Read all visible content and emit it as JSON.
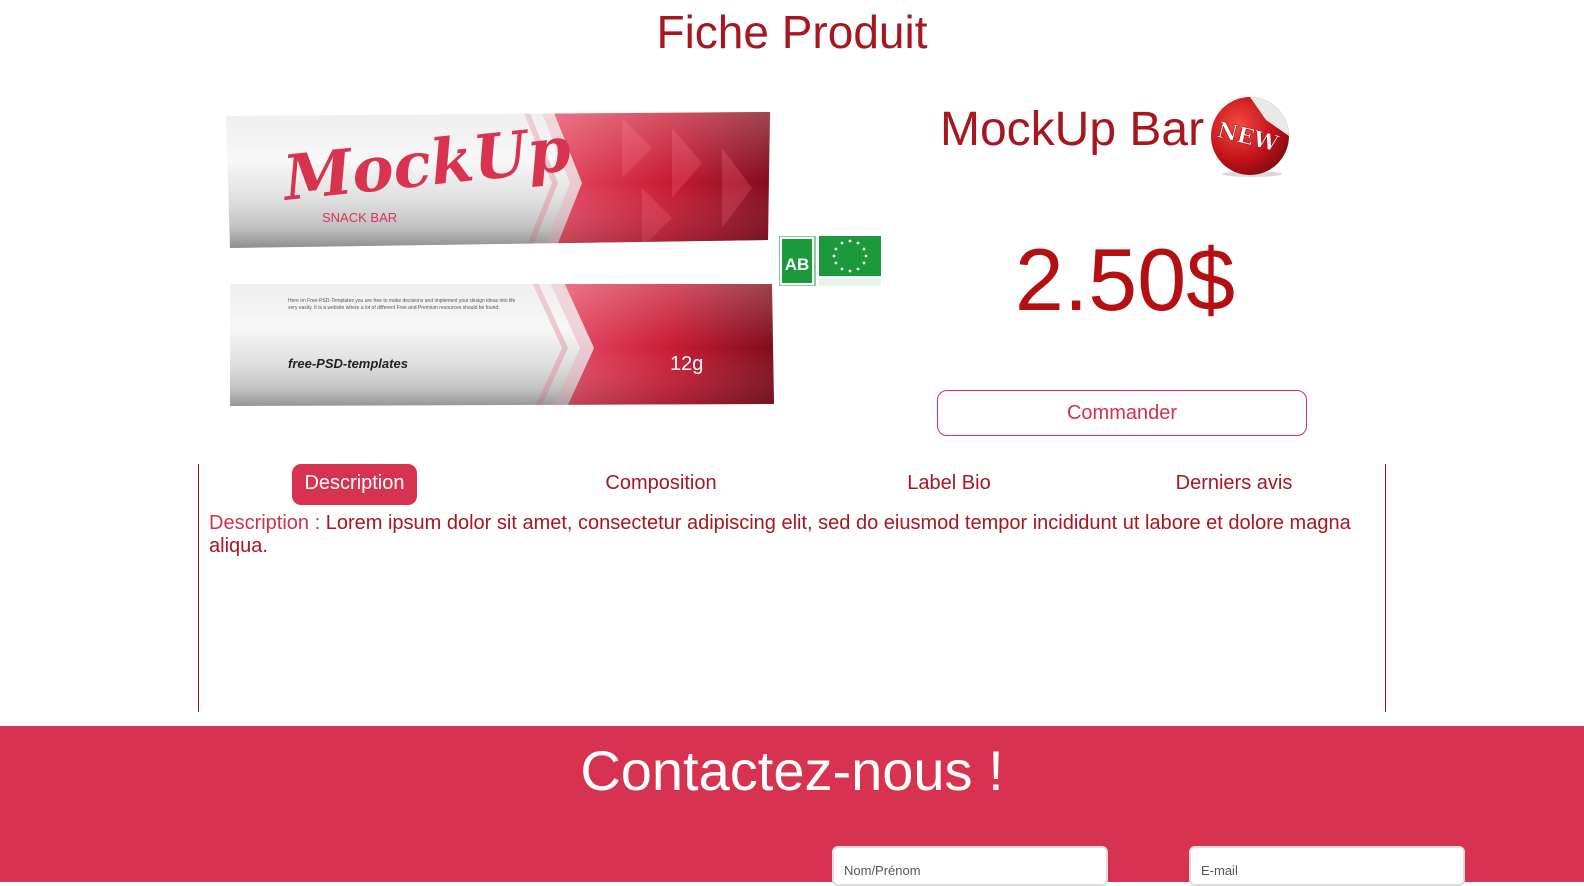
{
  "header": {
    "title": "Fiche Produit"
  },
  "product": {
    "name": "MockUp Bar",
    "badge": "NEW",
    "price": "2.50$",
    "order_label": "Commander",
    "image": {
      "brand": "MockUp",
      "subtitle": "SNACK BAR",
      "back_text_line1": "Here on Free-PSD-Templates you are free to make decisions and implement your design ideas into life",
      "back_text_line2": "very easily. It is a website where a lot of different Free and Premium resources should be found.",
      "back_logo": "free-PSD-templates",
      "weight": "12g"
    },
    "labels": {
      "ab": "AB"
    }
  },
  "tabs": [
    {
      "label": "Description",
      "active": true
    },
    {
      "label": "Composition",
      "active": false
    },
    {
      "label": "Label Bio",
      "active": false
    },
    {
      "label": "Derniers avis",
      "active": false
    }
  ],
  "tab_content": {
    "label": "Description :",
    "text": "Lorem ipsum dolor sit amet, consectetur adipiscing elit, sed do eiusmod tempor incididunt ut labore et dolore magna aliqua."
  },
  "contact": {
    "title": "Contactez-nous !",
    "name_placeholder": "Nom/Prénom",
    "email_placeholder": "E-mail"
  },
  "colors": {
    "dark_red": "#a8161f",
    "accent": "#d73350",
    "price": "#b40f12",
    "bio_green": "#1b9a3c"
  }
}
